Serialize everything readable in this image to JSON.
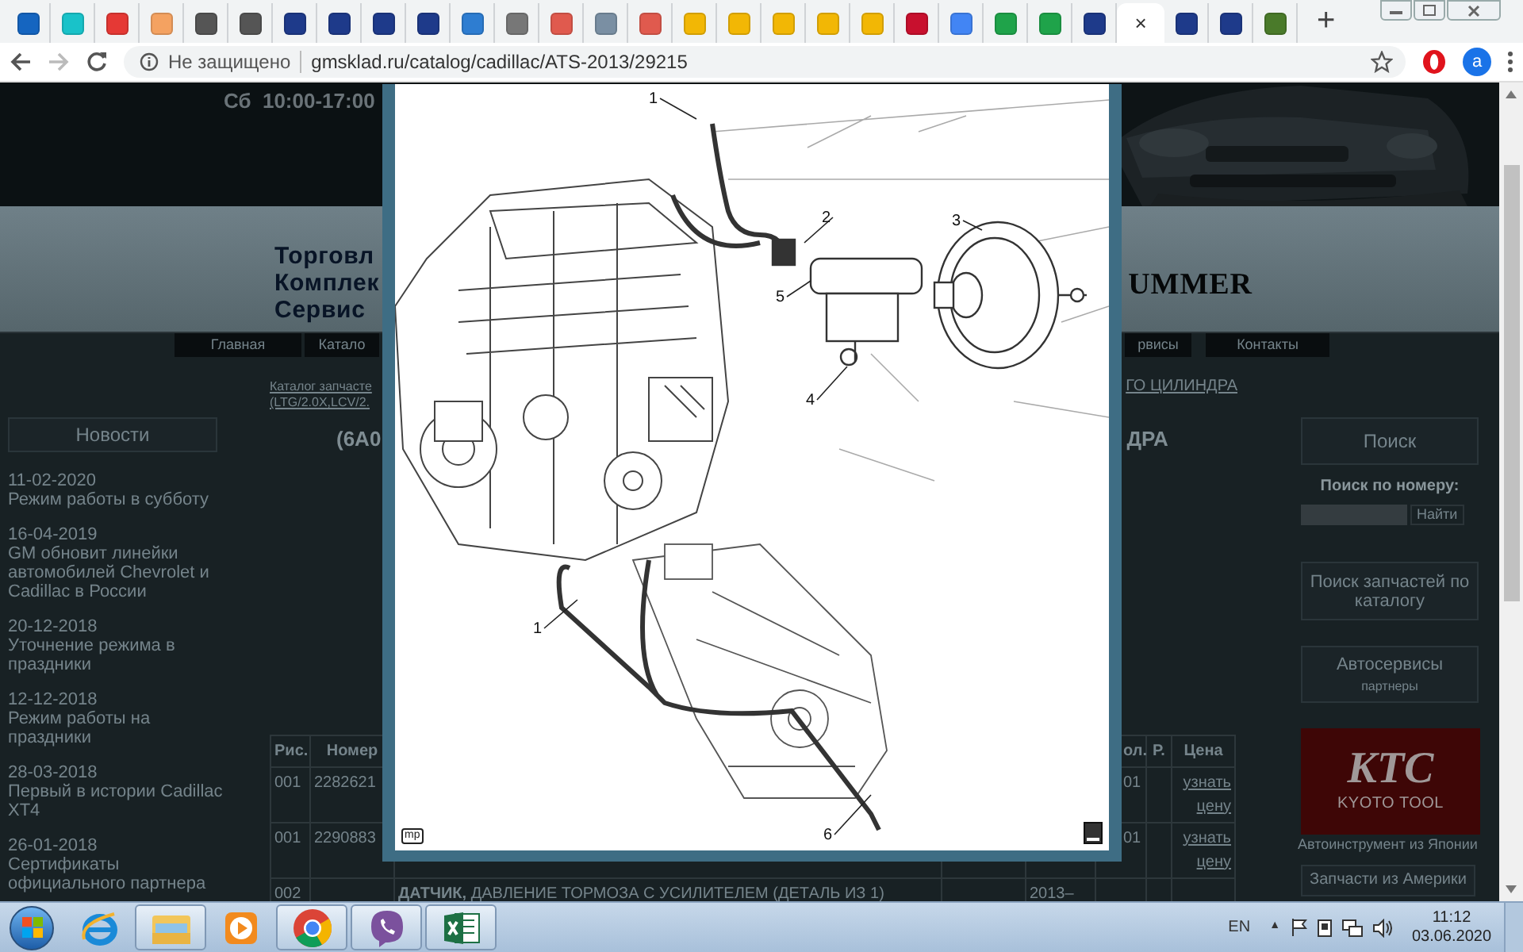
{
  "browser": {
    "tabs": [
      {
        "selected": false
      },
      {
        "selected": false
      },
      {
        "selected": false
      },
      {
        "selected": false
      },
      {
        "selected": false
      },
      {
        "selected": false
      },
      {
        "selected": false
      },
      {
        "selected": false
      },
      {
        "selected": false
      },
      {
        "selected": false
      },
      {
        "selected": false
      },
      {
        "selected": false
      },
      {
        "selected": false
      },
      {
        "selected": false
      },
      {
        "selected": false
      },
      {
        "selected": false
      },
      {
        "selected": false
      },
      {
        "selected": false
      },
      {
        "selected": false
      },
      {
        "selected": false
      },
      {
        "selected": false
      },
      {
        "selected": false
      },
      {
        "selected": false
      },
      {
        "selected": false
      },
      {
        "selected": false
      },
      {
        "selected": true
      },
      {
        "selected": false
      },
      {
        "selected": false
      },
      {
        "selected": false
      }
    ],
    "close_label": "×",
    "new_tab": "+",
    "security": "Не защищено",
    "url": "gmsklad.ru/catalog/cadillac/ATS-2013/29215",
    "profile": "a"
  },
  "header": {
    "hours": "Сб  10:00-17:00",
    "company_lines": [
      "Торговл",
      "Комплек",
      "Сервис"
    ],
    "brand": "UMMER"
  },
  "nav": [
    {
      "label": "Главная"
    },
    {
      "label": "Катало"
    },
    {
      "label": "рвисы"
    },
    {
      "label": "Контакты"
    }
  ],
  "breadcrumb": {
    "lines": [
      "Каталог запчасте",
      "(LTG/2.0X,LCV/2."
    ],
    "tail": "ГО ЦИЛИНДРА"
  },
  "title": {
    "left": "(6А0",
    "right": "ДРА"
  },
  "news": {
    "heading": "Новости",
    "items": [
      {
        "date": "11-02-2020",
        "title": "Режим работы в субботу"
      },
      {
        "date": "16-04-2019",
        "title": "GM обновит линейки автомобилей Chevrolet и Cadillac в России"
      },
      {
        "date": "20-12-2018",
        "title": "Уточнение режима в праздники"
      },
      {
        "date": "12-12-2018",
        "title": "Режим работы на праздники"
      },
      {
        "date": "28-03-2018",
        "title": "Первый в истории Cadillac XT4"
      },
      {
        "date": "26-01-2018",
        "title": "Сертификаты официального партнера"
      }
    ]
  },
  "table": {
    "columns": [
      "Рис.",
      "Номер",
      "ол.",
      "Р.",
      "Цена"
    ],
    "rows": [
      {
        "fig": "001",
        "number": "2282621",
        "qty": "01",
        "price": "узнать цену"
      },
      {
        "fig": "001",
        "number": "2290883",
        "qty": "01",
        "price": "узнать цену"
      },
      {
        "fig": "002",
        "description": "**ДАТЧИК,** ДАВЛЕНИЕ ТОРМОЗА С УСИЛИТЕЛЕМ (ДЕТАЛЬ ИЗ 1)",
        "years": "2013–"
      }
    ]
  },
  "sidebar": {
    "search_heading": "Поиск",
    "search_label": "Поиск по номеру:",
    "search_button": "Найти",
    "catalog_link": "Поиск запчастей по каталогу",
    "services": "Автосервисы",
    "services_sub": "партнеры",
    "banner": {
      "logo": "KTC",
      "sub": "KYOTO TOOL"
    },
    "banner_caption": "Автоинструмент из Японии",
    "america": "Запчасти из Америки"
  },
  "lightbox": {
    "callouts": [
      "1",
      "2",
      "3",
      "5",
      "4",
      "1",
      "6"
    ],
    "corner_label": "mp"
  },
  "taskbar": {
    "apps": [
      {
        "kind": "ie",
        "running": false
      },
      {
        "kind": "explorer",
        "running": true
      },
      {
        "kind": "media",
        "running": false
      },
      {
        "kind": "chrome",
        "running": true
      },
      {
        "kind": "viber",
        "running": true
      },
      {
        "kind": "excel",
        "running": true
      }
    ],
    "lang": "EN",
    "tray_arrow": "▲",
    "time": "11:12",
    "date": "03.06.2020"
  }
}
